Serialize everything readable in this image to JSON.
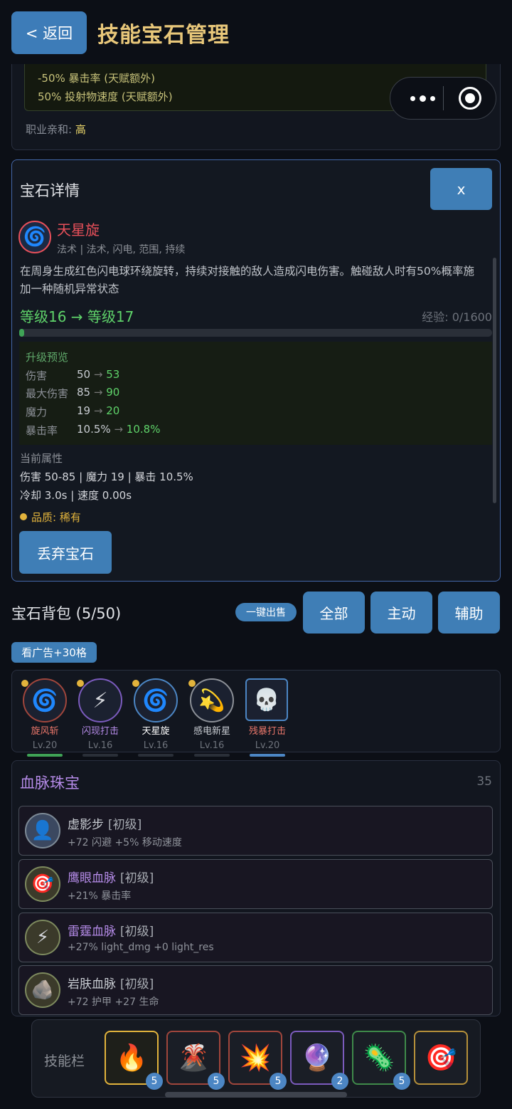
{
  "header": {
    "back_label": "< 返回",
    "title": "技能宝石管理"
  },
  "top_card": {
    "lines": [
      "-50% 暴击率 (天赋额外)",
      "50% 投射物速度 (天赋额外)"
    ],
    "affinity_label": "职业亲和:",
    "affinity_value": "高"
  },
  "detail": {
    "title": "宝石详情",
    "close_label": "x",
    "gem_name": "天星旋",
    "gem_tags": "法术 | 法术, 闪电, 范围, 持续",
    "description": "在周身生成红色闪电球环绕旋转，持续对接触的敌人造成闪电伤害。触碰敌人时有50%概率施加一种随机异常状态",
    "level_text": "等级16 → 等级17",
    "exp_text": "经验: 0/1600",
    "exp_progress": 0.0,
    "preview_title": "升级预览",
    "preview_rows": [
      {
        "label": "伤害",
        "from": "50",
        "to": "53"
      },
      {
        "label": "最大伤害",
        "from": "85",
        "to": "90"
      },
      {
        "label": "魔力",
        "from": "19",
        "to": "20"
      },
      {
        "label": "暴击率",
        "from": "10.5%",
        "to": "10.8%"
      }
    ],
    "arrow": "→",
    "current_title": "当前属性",
    "current_line1": "伤害 50-85 | 魔力 19 | 暴击 10.5%",
    "current_line2": "冷却 3.0s | 速度 0.00s",
    "quality_text": "品质: 稀有",
    "discard_label": "丢弃宝石"
  },
  "bag": {
    "title": "宝石背包 (5/50)",
    "sell_all_label": "一键出售",
    "filters": [
      "全部",
      "主动",
      "辅助"
    ],
    "ad_label": "看广告+30格",
    "gems": [
      {
        "name": "旋风斩",
        "level": "Lv.20",
        "icon": "spiral-icon",
        "glyph": "🌀",
        "color": "#e8766a",
        "border": "#a0463c",
        "dot": true
      },
      {
        "name": "闪现打击",
        "level": "Lv.16",
        "icon": "lightning-icon",
        "glyph": "⚡",
        "color": "#b58be8",
        "border": "#7b5bbd",
        "dot": true
      },
      {
        "name": "天星旋",
        "level": "Lv.16",
        "icon": "spiral-icon",
        "glyph": "🌀",
        "color": "#ffffff",
        "border": "#4c86c4",
        "dot": true
      },
      {
        "name": "感电新星",
        "level": "Lv.16",
        "icon": "comet-icon",
        "glyph": "💫",
        "color": "#c8ccd2",
        "border": "#8c9097",
        "dot": true
      },
      {
        "name": "残暴打击",
        "level": "Lv.20",
        "icon": "skull-icon",
        "glyph": "💀",
        "color": "#e8766a",
        "border": "#4c86c4",
        "dot": false
      }
    ]
  },
  "bloodline": {
    "title": "血脉珠宝",
    "count": "35",
    "items": [
      {
        "name": "虚影步",
        "grade": "[初级]",
        "stats": "+72 闪避  +5% 移动速度",
        "icon": "silhouette-icon",
        "glyph": "👤",
        "name_color": "#c8ccd2"
      },
      {
        "name": "鹰眼血脉",
        "grade": "[初级]",
        "stats": "+21% 暴击率",
        "icon": "target-icon",
        "glyph": "🎯",
        "name_color": "#b58be8"
      },
      {
        "name": "雷霆血脉",
        "grade": "[初级]",
        "stats": "+27% light_dmg  +0 light_res",
        "icon": "lightning-icon",
        "glyph": "⚡",
        "name_color": "#b58be8"
      },
      {
        "name": "岩肤血脉",
        "grade": "[初级]",
        "stats": "+72 护甲  +27 生命",
        "icon": "rock-icon",
        "glyph": "🪨",
        "name_color": "#c8ccd2"
      }
    ]
  },
  "skillbar": {
    "label": "技能栏",
    "slots": [
      {
        "icon": "fire-icon",
        "glyph": "🔥",
        "count": "5",
        "border": "#e2b33c"
      },
      {
        "icon": "volcano-icon",
        "glyph": "🌋",
        "count": "5",
        "border": "#a0463c"
      },
      {
        "icon": "explosion-icon",
        "glyph": "💥",
        "count": "5",
        "border": "#a0463c"
      },
      {
        "icon": "crystal-ball-icon",
        "glyph": "🔮",
        "count": "2",
        "border": "#7b5bbd"
      },
      {
        "icon": "microbe-icon",
        "glyph": "🦠",
        "count": "5",
        "border": "#3f8a4a"
      },
      {
        "icon": "target-icon",
        "glyph": "🎯",
        "count": "",
        "border": "#b5903a"
      }
    ]
  },
  "colors": {
    "accent": "#3f7eb6",
    "title_gold": "#e8c77a",
    "green": "#5fd36a",
    "red_name": "#e8505a"
  }
}
